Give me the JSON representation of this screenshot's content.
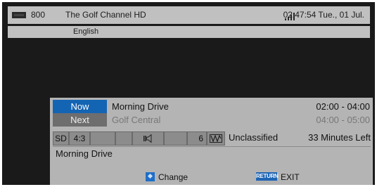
{
  "channel": {
    "number": "800",
    "name": "The Golf Channel HD",
    "datetime": "02:47:54 Tue., 01 Jul.",
    "language": "English"
  },
  "epg": {
    "now": {
      "label": "Now",
      "title": "Morning Drive",
      "time": "02:00 - 04:00"
    },
    "next": {
      "label": "Next",
      "title": "Golf Central",
      "time": "04:00 - 05:00"
    },
    "attributes": {
      "definition": "SD",
      "aspect": "4:3",
      "audio_channel": "6",
      "rating": "Unclassified",
      "remaining": "33 Minutes Left"
    },
    "description": "Morning Drive"
  },
  "footer": {
    "change_label": "Change",
    "return_key": "RETURN",
    "exit_label": "EXIT"
  },
  "colors": {
    "now_highlight": "#1464b4",
    "bar_bg": "#c0c0c0",
    "panel_bg": "#b4b4b4"
  }
}
